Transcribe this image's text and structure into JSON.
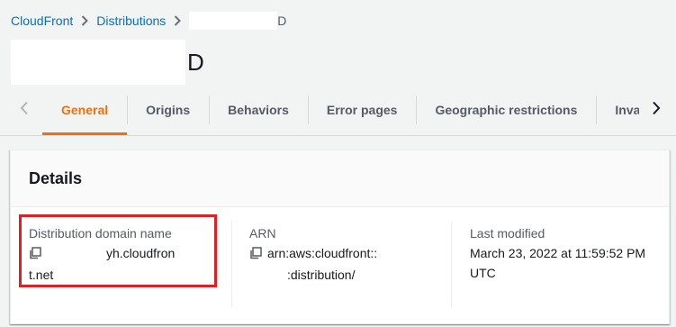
{
  "breadcrumb": {
    "items": [
      "CloudFront",
      "Distributions"
    ],
    "current_suffix": "D"
  },
  "page": {
    "title_suffix": "D"
  },
  "tabs": [
    {
      "label": "General",
      "active": true
    },
    {
      "label": "Origins",
      "active": false
    },
    {
      "label": "Behaviors",
      "active": false
    },
    {
      "label": "Error pages",
      "active": false
    },
    {
      "label": "Geographic restrictions",
      "active": false
    },
    {
      "label": "Invali",
      "active": false
    }
  ],
  "details": {
    "heading": "Details",
    "domain": {
      "label": "Distribution domain name",
      "value_line1": "yh.cloudfron",
      "value_line2": "t.net"
    },
    "arn": {
      "label": "ARN",
      "value_line1": "arn:aws:cloudfront::",
      "value_line2": ":distribution/"
    },
    "modified": {
      "label": "Last modified",
      "value_line1": "March 23, 2022 at 11:59:52 PM",
      "value_line2": "UTC"
    }
  },
  "colors": {
    "link": "#0073bb",
    "active_tab": "#ec7211",
    "highlight": "#e02020",
    "background": "#f2f3f3"
  },
  "icons": [
    "chevron-right-icon",
    "chevron-left-icon",
    "copy-icon"
  ]
}
